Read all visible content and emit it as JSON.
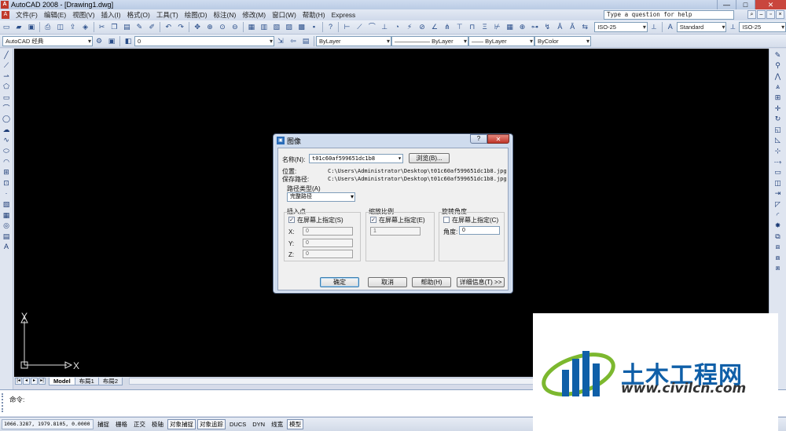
{
  "window": {
    "title": "AutoCAD 2008 - [Drawing1.dwg]",
    "minimize": "—",
    "maximize": "□",
    "close": "✕"
  },
  "menu": {
    "items": [
      "文件(F)",
      "编辑(E)",
      "视图(V)",
      "插入(I)",
      "格式(O)",
      "工具(T)",
      "绘图(D)",
      "标注(N)",
      "修改(M)",
      "窗口(W)",
      "帮助(H)",
      "Express"
    ],
    "help_search_placeholder": "Type a question for help"
  },
  "toolbar1": {
    "dimstyle": "ISO-25",
    "textstyle": "Standard",
    "tablestyle": "ISO-25"
  },
  "toolbar2": {
    "workspace": "AutoCAD 经典",
    "layer": "0",
    "color": "ByLayer",
    "linetype": "—————— ByLayer",
    "lineweight": "—— ByLayer",
    "plotstyle": "ByColor"
  },
  "tabs": [
    "Model",
    "布局1",
    "布局2"
  ],
  "command": {
    "prompt": "命令:"
  },
  "status": {
    "coords": "1066.3287, 1979.8105, 0.0000",
    "buttons": [
      {
        "label": "捕捉",
        "on": false
      },
      {
        "label": "栅格",
        "on": false
      },
      {
        "label": "正交",
        "on": false
      },
      {
        "label": "极轴",
        "on": false
      },
      {
        "label": "对象捕捉",
        "on": true
      },
      {
        "label": "对象追踪",
        "on": true
      },
      {
        "label": "DUCS",
        "on": false
      },
      {
        "label": "DYN",
        "on": false
      },
      {
        "label": "线宽",
        "on": false
      },
      {
        "label": "模型",
        "on": true
      }
    ]
  },
  "ucs": {
    "x_label": "X",
    "y_label": "Y"
  },
  "dialog": {
    "title": "图像",
    "help_btn": "?",
    "close_btn": "✕",
    "name_label": "名称(N):",
    "name_value": "t01c60af599651dc1b8",
    "browse_btn": "浏览(B)...",
    "location_label": "位置:",
    "location_value": "C:\\Users\\Administrator\\Desktop\\t01c60af599651dc1b8.jpg",
    "saved_path_label": "保存路径:",
    "saved_path_value": "C:\\Users\\Administrator\\Desktop\\t01c60af599651dc1b8.jpg",
    "path_type_label": "路径类型(A)",
    "path_type_value": "完整路径",
    "insertion": {
      "title": "插入点",
      "specify": "在屏幕上指定(S)",
      "specify_checked": true,
      "x_label": "X:",
      "x_value": "0",
      "y_label": "Y:",
      "y_value": "0",
      "z_label": "Z:",
      "z_value": "0"
    },
    "scale": {
      "title": "缩放比例",
      "specify": "在屏幕上指定(E)",
      "specify_checked": true,
      "value": "1"
    },
    "rotation": {
      "title": "旋转角度",
      "specify": "在屏幕上指定(C)",
      "specify_checked": false,
      "angle_label": "角度:",
      "angle_value": "0"
    },
    "ok_btn": "确定",
    "cancel_btn": "取消",
    "help_button": "帮助(H)",
    "details_btn": "详细信息(T) >>"
  },
  "watermark": {
    "brand": "土木工程网",
    "url": "www.civilcn.com"
  },
  "colors": {
    "canvas": "#000000",
    "dialog_frame": "#cfdcee",
    "watermark_blue": "#0f5fa8",
    "watermark_green": "#7cb82f"
  }
}
